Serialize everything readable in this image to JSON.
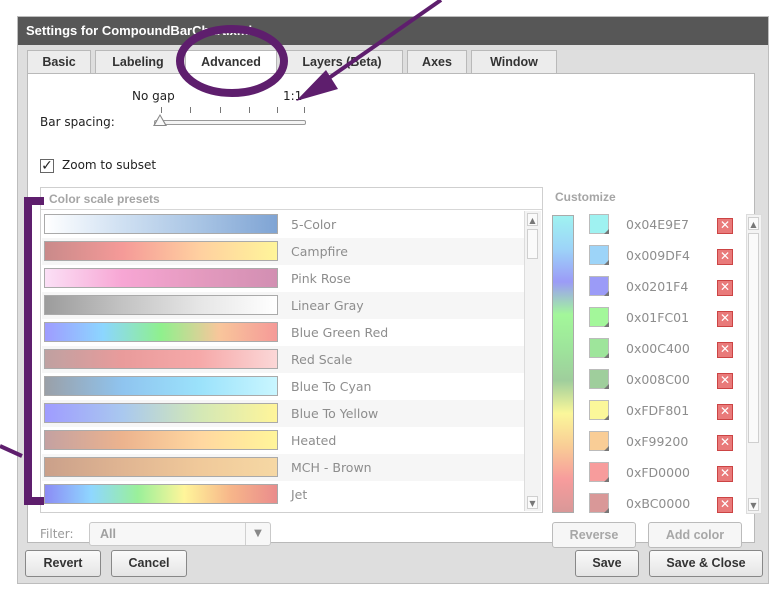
{
  "window": {
    "title": "Settings for CompoundBarChart.xml"
  },
  "tabs": [
    {
      "label": "Basic"
    },
    {
      "label": "Labeling"
    },
    {
      "label": "Advanced"
    },
    {
      "label": "Layers (Beta)"
    },
    {
      "label": "Axes"
    },
    {
      "label": "Window"
    }
  ],
  "bar_spacing": {
    "label": "Bar spacing:",
    "min_label": "No gap",
    "max_label": "1:1",
    "value": 0
  },
  "zoom": {
    "label": "Zoom to subset",
    "checked": true
  },
  "presets": {
    "header": "Color scale presets",
    "items": [
      {
        "name": "5-Color",
        "gradient": "linear-gradient(to right,#ffffff,#cfe0f2,#a8c4e4,#7fa4d4)"
      },
      {
        "name": "Campfire",
        "gradient": "linear-gradient(to right,#c98a8a,#f59a98,#ffd0a0,#fff59a)"
      },
      {
        "name": "Pink Rose",
        "gradient": "linear-gradient(to right,#fbe0f6,#f7a6d4,#e49abf,#d28fb2)"
      },
      {
        "name": "Linear Gray",
        "gradient": "linear-gradient(to right,#9c9c9c,#c3c3c3,#e6e6e6,#ffffff)"
      },
      {
        "name": "Blue Green Red",
        "gradient": "linear-gradient(to right,#9f9cff,#8cd6ff,#8ff08d,#f8c69b,#f59a98)"
      },
      {
        "name": "Red Scale",
        "gradient": "linear-gradient(to right,#bfa1a1,#e99b9b,#f6a9a9,#fbd7d7)"
      },
      {
        "name": "Blue To Cyan",
        "gradient": "linear-gradient(to right,#9aa0a8,#8fc4ef,#9be2fb,#c9f6ff)"
      },
      {
        "name": "Blue To Yellow",
        "gradient": "linear-gradient(to right,#9f9cff,#a9c8ef,#d3e8b6,#fff59a)"
      },
      {
        "name": "Heated",
        "gradient": "linear-gradient(to right,#c4a1a1,#ecb38e,#ffd7a0,#fff59a)"
      },
      {
        "name": "MCH - Brown",
        "gradient": "linear-gradient(to right,#caa08a,#e0b592,#f0c99a,#f6d8a4)"
      },
      {
        "name": "Jet",
        "gradient": "linear-gradient(to right,#8c8cf5,#8fd7ff,#9af09a,#fff59a,#f7b68a,#ea8c8c)"
      }
    ]
  },
  "filter": {
    "label": "Filter:",
    "value": "All"
  },
  "customize": {
    "title": "Customize",
    "colors": [
      {
        "hex": "0x04E9E7",
        "color": "#9ff2f1"
      },
      {
        "hex": "0x009DF4",
        "color": "#9dd4f8"
      },
      {
        "hex": "0x0201F4",
        "color": "#9b9bf7"
      },
      {
        "hex": "0x01FC01",
        "color": "#a3f79a"
      },
      {
        "hex": "0x00C400",
        "color": "#9ee59b"
      },
      {
        "hex": "0x008C00",
        "color": "#9fce9c"
      },
      {
        "hex": "0xFDF801",
        "color": "#fbf79a"
      },
      {
        "hex": "0xF99200",
        "color": "#f9cd96"
      },
      {
        "hex": "0xFD0000",
        "color": "#f79c9c"
      },
      {
        "hex": "0xBC0000",
        "color": "#d99898"
      }
    ],
    "reverse_label": "Reverse",
    "add_label": "Add color"
  },
  "buttons": {
    "revert": "Revert",
    "cancel": "Cancel",
    "save": "Save",
    "save_close": "Save & Close"
  },
  "colors": {
    "annotation": "#5e1e6d",
    "titlebar": "#575757",
    "dialog_bg": "#dedede"
  }
}
